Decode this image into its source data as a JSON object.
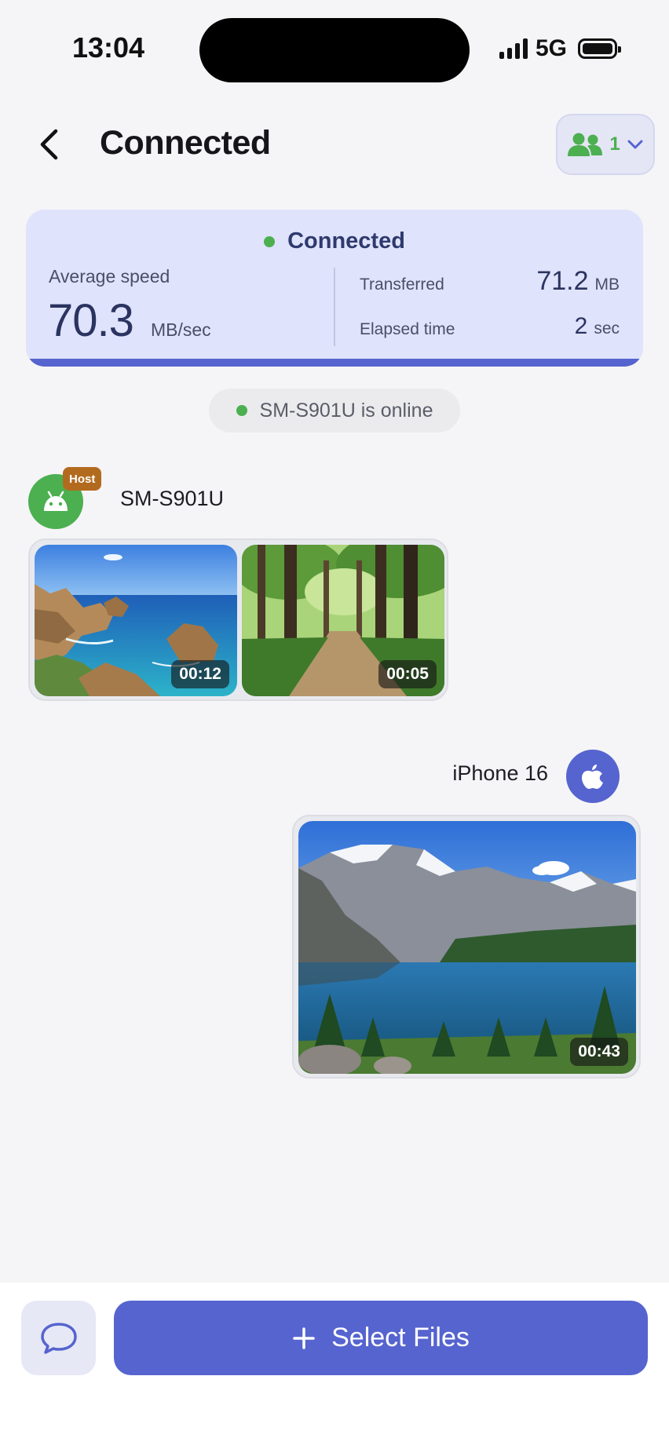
{
  "status_bar": {
    "time": "13:04",
    "network": "5G"
  },
  "header": {
    "title": "Connected",
    "peer_count": "1"
  },
  "stats": {
    "status": "Connected",
    "average_speed_label": "Average speed",
    "average_speed_value": "70.3",
    "average_speed_unit": "MB/sec",
    "transferred_label": "Transferred",
    "transferred_value": "71.2",
    "transferred_unit": "MB",
    "elapsed_label": "Elapsed time",
    "elapsed_value": "2",
    "elapsed_unit": "sec"
  },
  "online_notice": "SM-S901U is online",
  "host": {
    "badge": "Host",
    "name": "SM-S901U",
    "media": [
      {
        "scene": "coastline",
        "duration": "00:12"
      },
      {
        "scene": "forest-path",
        "duration": "00:05"
      }
    ]
  },
  "self": {
    "name": "iPhone 16",
    "media": [
      {
        "scene": "mountain-lake",
        "duration": "00:43"
      }
    ]
  },
  "actions": {
    "select_files": "Select Files"
  },
  "colors": {
    "accent": "#5664cf",
    "online": "#4caf50",
    "host_badge": "#b26b1e",
    "card_bg": "#dfe3fb"
  }
}
